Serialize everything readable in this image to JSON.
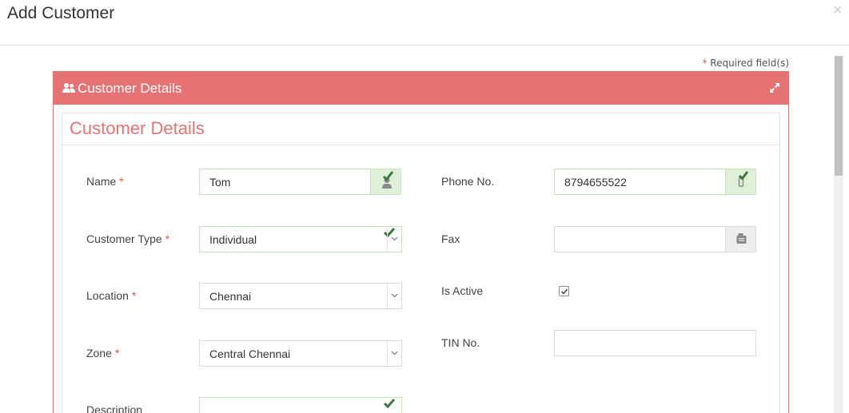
{
  "modal": {
    "title": "Add Customer",
    "close_icon": "×"
  },
  "required_note": {
    "star": "*",
    "text": " Required field(s)"
  },
  "portlet": {
    "header_title": "Customer Details",
    "header_icon": "users-icon",
    "expand_icon": "expand-icon",
    "accent_color": "#e57373"
  },
  "section": {
    "title": "Customer Details"
  },
  "form": {
    "name": {
      "label": "Name",
      "required": "*",
      "value": "Tom",
      "icon": "user-icon"
    },
    "customer_type": {
      "label": "Customer Type",
      "required": "*",
      "value": "Individual"
    },
    "location": {
      "label": "Location",
      "required": "*",
      "value": "Chennai"
    },
    "zone": {
      "label": "Zone",
      "required": "*",
      "value": "Central Chennai"
    },
    "description": {
      "label": "Description",
      "value": ""
    },
    "phone": {
      "label": "Phone No.",
      "value": "8794655522",
      "icon": "mobile-icon"
    },
    "fax": {
      "label": "Fax",
      "value": "",
      "icon": "fax-icon"
    },
    "is_active": {
      "label": "Is Active",
      "checked": true
    },
    "tin": {
      "label": "TIN No.",
      "value": ""
    }
  },
  "colors": {
    "success_border": "#c7e2b9",
    "success_fill": "#dff0d8",
    "check_green": "#3c763d",
    "required_red": "#e0514f"
  }
}
